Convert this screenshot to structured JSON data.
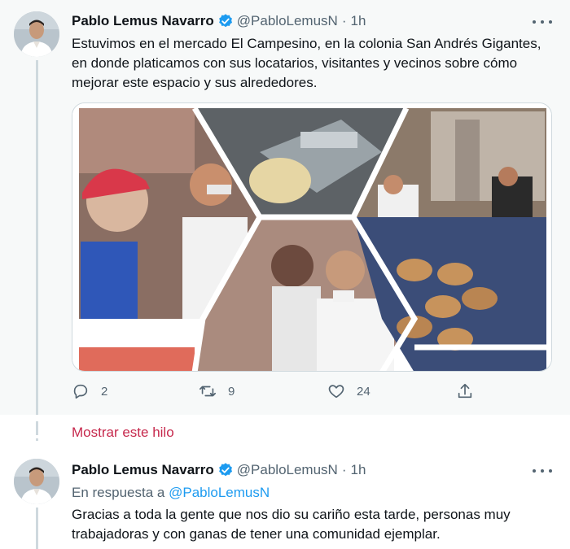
{
  "tweet1": {
    "author_name": "Pablo Lemus Navarro",
    "handle": "@PabloLemusN",
    "separator": "·",
    "time": "1h",
    "text_lines": [
      "Estuvimos en el mercado El Campesino, en la colonia San Andrés Gigantes,",
      "en donde platicamos con sus locatarios, visitantes y vecinos sobre cómo",
      "mejorar este espacio y sus alrededores."
    ],
    "actions": {
      "reply_count": "2",
      "retweet_count": "9",
      "like_count": "24"
    }
  },
  "show_thread": {
    "label": "Mostrar este hilo"
  },
  "tweet2": {
    "author_name": "Pablo Lemus Navarro",
    "handle": "@PabloLemusN",
    "separator": "·",
    "time": "1h",
    "reply_prefix": "En respuesta a",
    "reply_mention": "@PabloLemusN",
    "text_lines": [
      "Gracias a toda la gente que nos dio su cariño esta tarde, personas muy",
      "trabajadoras y con ganas de tener una comunidad ejemplar."
    ]
  },
  "icons": {
    "verified": "verified-badge-icon",
    "more": "more-options-icon",
    "reply": "reply-icon",
    "retweet": "retweet-icon",
    "like": "heart-icon",
    "share": "share-icon"
  },
  "colors": {
    "verified_blue": "#1d9bf0",
    "thread_link": "#c6284c",
    "muted": "#536471",
    "mention": "#1d9bf0"
  }
}
